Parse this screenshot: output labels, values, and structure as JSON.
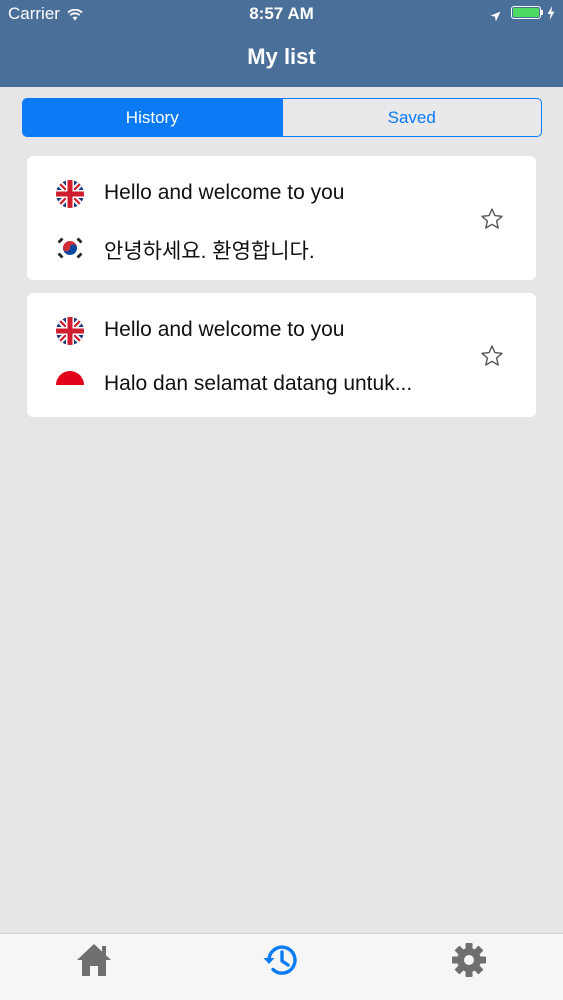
{
  "status_bar": {
    "carrier": "Carrier",
    "time": "8:57 AM",
    "battery_color": "#4cd964"
  },
  "header": {
    "title": "My list",
    "background": "#4a6f98"
  },
  "segments": [
    {
      "label": "History",
      "active": true
    },
    {
      "label": "Saved",
      "active": false
    }
  ],
  "accent_color": "#0a7af5",
  "items": [
    {
      "source": {
        "flag": "uk-flag-icon",
        "text": "Hello and welcome to you"
      },
      "target": {
        "flag": "south-korea-flag-icon",
        "text": "안녕하세요. 환영합니다."
      },
      "saved": false
    },
    {
      "source": {
        "flag": "uk-flag-icon",
        "text": "Hello and welcome to you"
      },
      "target": {
        "flag": "indonesia-flag-icon",
        "text": "Halo dan selamat datang untuk..."
      },
      "saved": false
    }
  ],
  "tab_bar": {
    "tabs": [
      {
        "icon": "home-icon",
        "active": false
      },
      {
        "icon": "history-icon",
        "active": true
      },
      {
        "icon": "gear-icon",
        "active": false
      }
    ]
  }
}
